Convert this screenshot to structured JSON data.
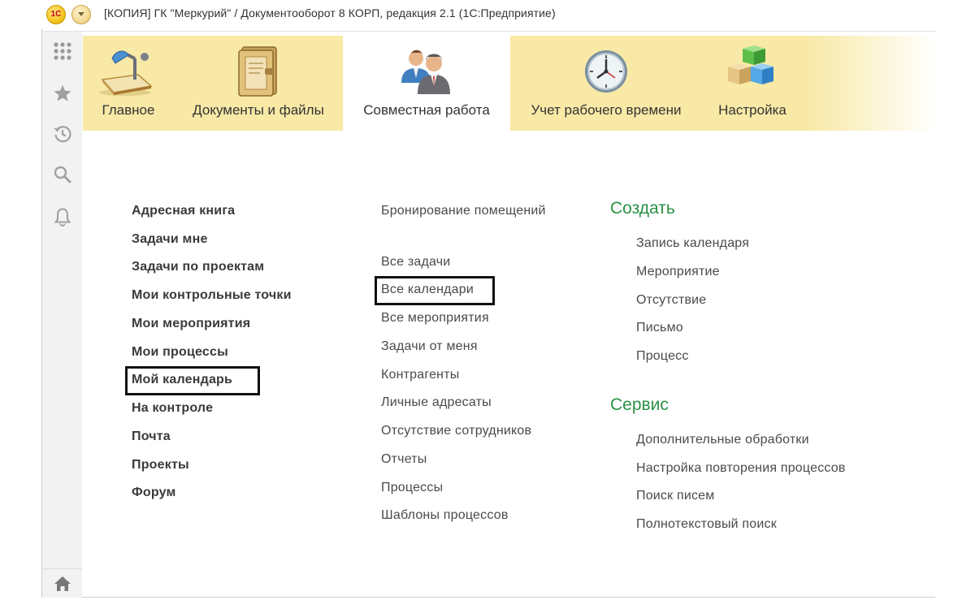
{
  "window": {
    "logo": "1С",
    "title": "[КОПИЯ] ГК \"Меркурий\" / Документооборот 8 КОРП, редакция 2.1   (1С:Предприятие)"
  },
  "tool_panel": {
    "icons": [
      "apps-grid-icon",
      "star-icon",
      "history-icon",
      "search-icon",
      "bell-icon",
      "home-icon"
    ]
  },
  "sections": [
    {
      "label": "Главное",
      "icon": "desk-lamp-icon",
      "active": false
    },
    {
      "label": "Документы и файлы",
      "icon": "binder-icon",
      "active": false
    },
    {
      "label": "Совместная работа",
      "icon": "people-icon",
      "active": true
    },
    {
      "label": "Учет рабочего времени",
      "icon": "clock-icon",
      "active": false
    },
    {
      "label": "Настройка",
      "icon": "cubes-icon",
      "active": false
    }
  ],
  "column1": [
    "Адресная книга",
    "Задачи мне",
    "Задачи по проектам",
    "Мои контрольные точки",
    "Мои мероприятия",
    "Мои процессы",
    "Мой календарь",
    "На контроле",
    "Почта",
    "Проекты",
    "Форум"
  ],
  "column2_top": "Бронирование помещений",
  "column2": [
    "Все задачи",
    "Все календари",
    "Все мероприятия",
    "Задачи от меня",
    "Контрагенты",
    "Личные адресаты",
    "Отсутствие сотрудников",
    "Отчеты",
    "Процессы",
    "Шаблоны процессов"
  ],
  "create": {
    "title": "Создать",
    "items": [
      "Запись календаря",
      "Мероприятие",
      "Отсутствие",
      "Письмо",
      "Процесс"
    ]
  },
  "service": {
    "title": "Сервис",
    "items": [
      "Дополнительные обработки",
      "Настройка повторения процессов",
      "Поиск писем",
      "Полнотекстовый поиск"
    ]
  },
  "colors": {
    "section_bar": "#f8e9a6",
    "group_title": "#2b9145",
    "highlight_box": "#111111"
  }
}
